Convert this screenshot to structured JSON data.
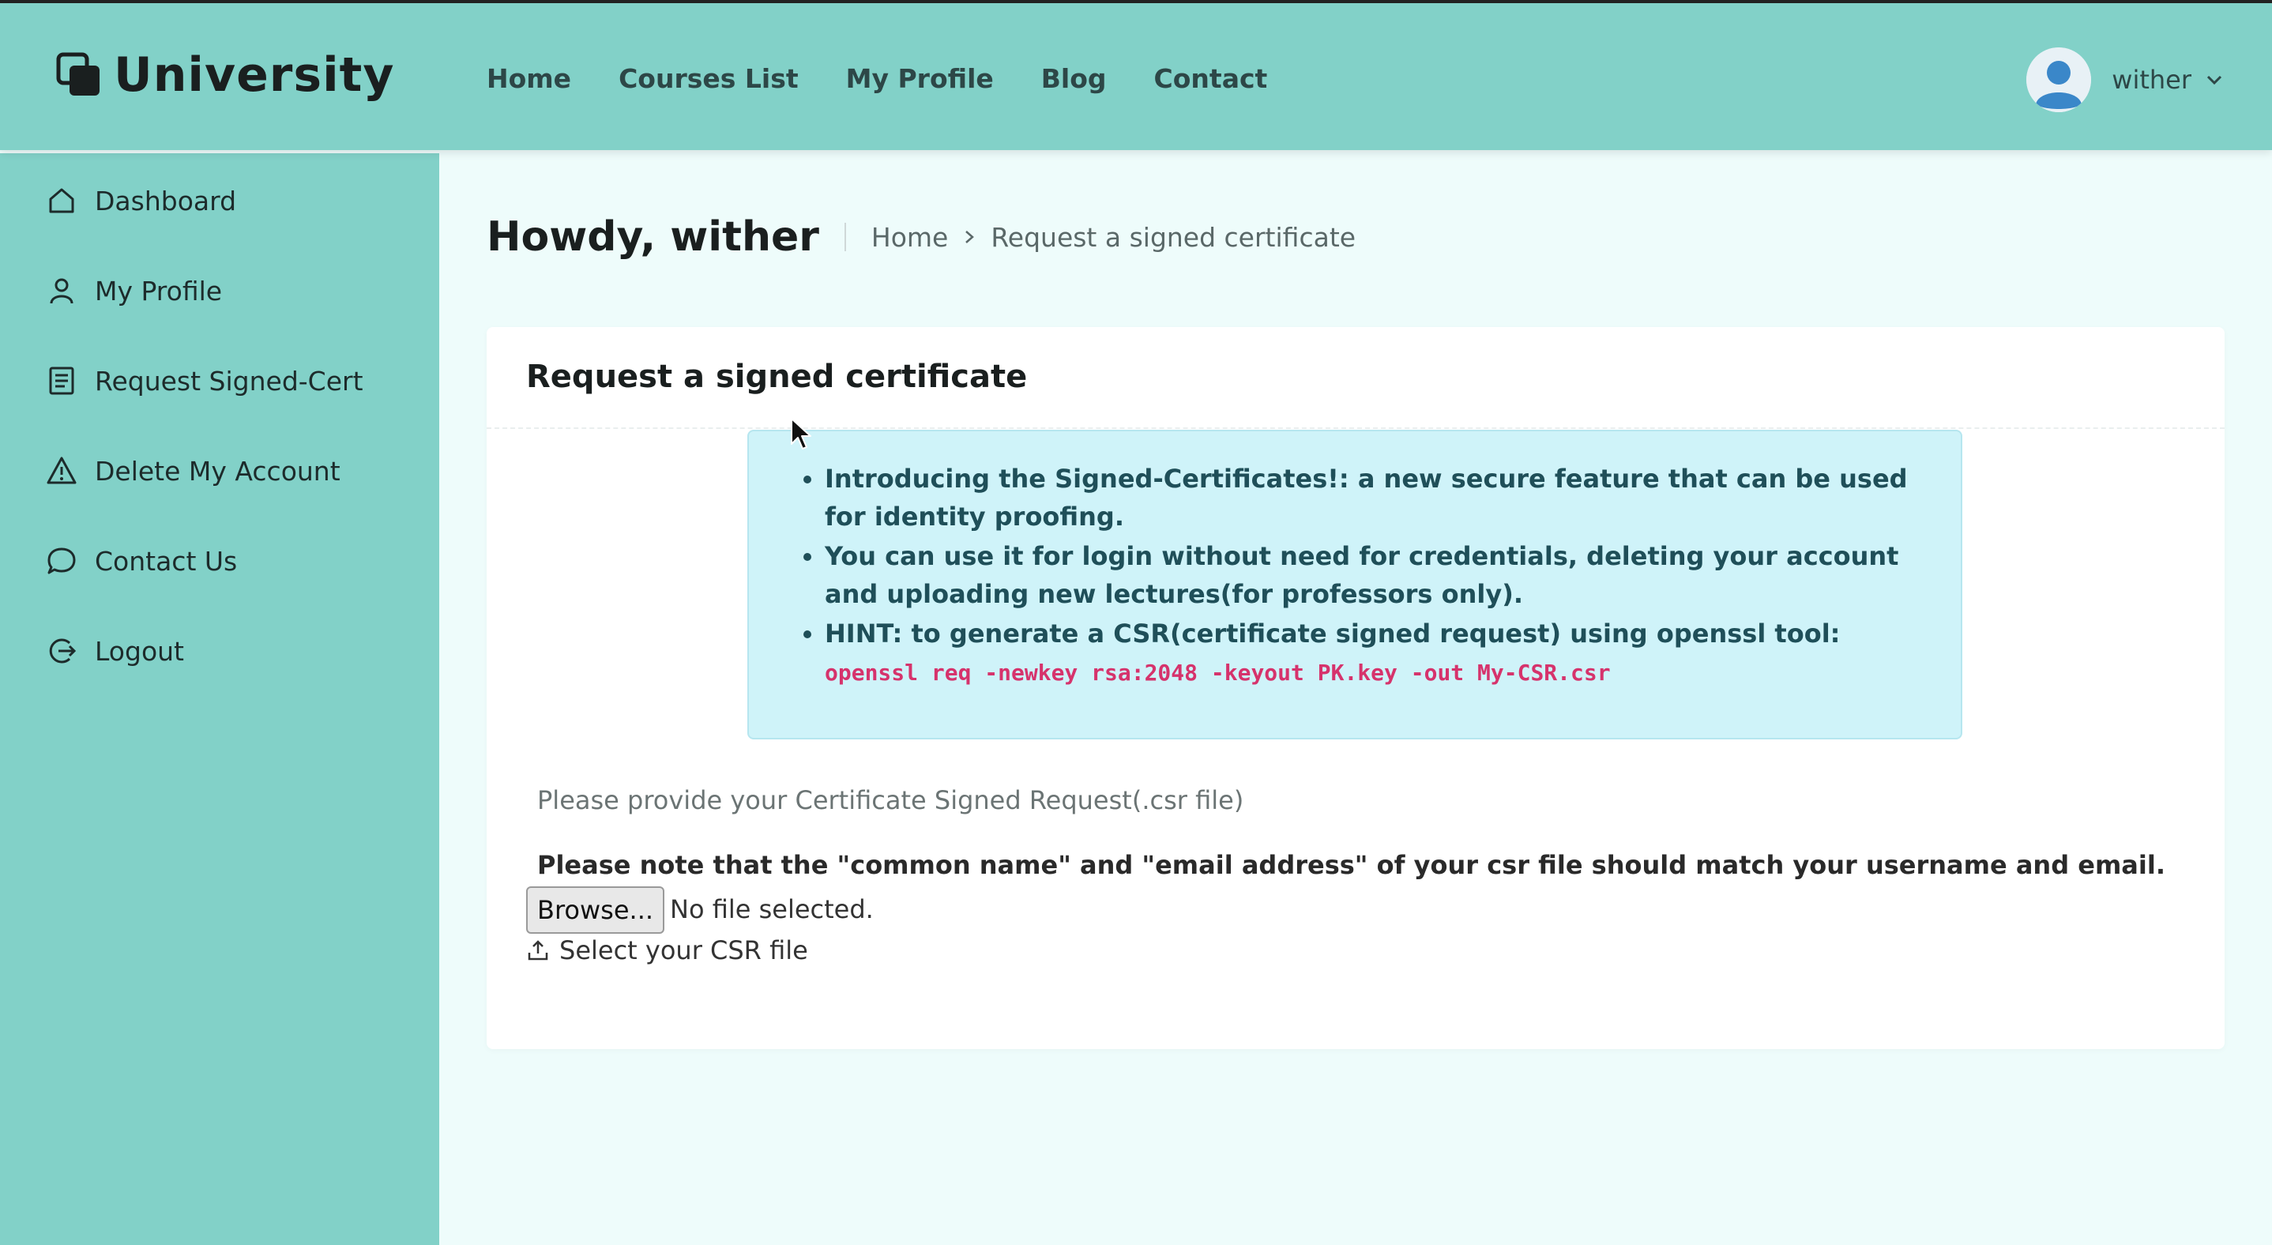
{
  "brand": {
    "name": "University"
  },
  "nav": [
    "Home",
    "Courses List",
    "My Profile",
    "Blog",
    "Contact"
  ],
  "user": {
    "name": "wither"
  },
  "sidebar": [
    {
      "label": "Dashboard",
      "icon": "home-icon"
    },
    {
      "label": "My Profile",
      "icon": "user-icon"
    },
    {
      "label": "Request Signed-Cert",
      "icon": "document-icon"
    },
    {
      "label": "Delete My Account",
      "icon": "warning-icon"
    },
    {
      "label": "Contact Us",
      "icon": "chat-bubble-icon"
    },
    {
      "label": "Logout",
      "icon": "logout-icon"
    }
  ],
  "header": {
    "greeting": "Howdy, wither",
    "breadcrumb": [
      "Home",
      "Request a signed certificate"
    ]
  },
  "card": {
    "title": "Request a signed certificate",
    "info": [
      "Introducing the Signed-Certificates!: a new secure feature that can be used for identity proofing.",
      "You can use it for login without need for credentials, deleting your account and uploading new lectures(for professors only).",
      "HINT: to generate a CSR(certificate signed request) using openssl tool:"
    ],
    "command": "openssl req -newkey rsa:2048 -keyout PK.key -out My-CSR.csr",
    "csr_label": "Please provide your Certificate Signed Request(.csr file)",
    "note": "Please note that the \"common name\" and \"email address\" of your csr file should match your username and email.",
    "browse_label": "Browse...",
    "file_status": "No file selected.",
    "select_label": "Select your CSR file"
  },
  "colors": {
    "primary": "#82d1c8",
    "background": "#eefcfb",
    "info_bg": "#cff3f9",
    "code": "#d6336c"
  }
}
